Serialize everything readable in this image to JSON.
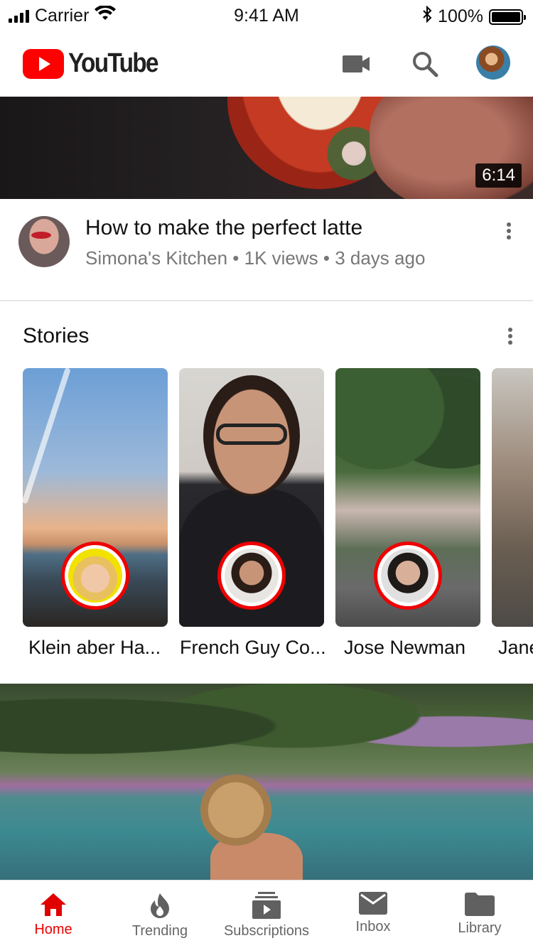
{
  "status_bar": {
    "carrier": "Carrier",
    "time": "9:41 AM",
    "battery": "100%"
  },
  "header": {
    "logo_text": "YouTube",
    "icons": [
      "video-camera-icon",
      "search-icon",
      "avatar"
    ]
  },
  "featured_video": {
    "duration": "6:14",
    "title": "How to make the perfect latte",
    "meta": "Simona's Kitchen • 1K views • 3 days ago"
  },
  "stories": {
    "title": "Stories",
    "items": [
      {
        "label": "Klein aber Ha..."
      },
      {
        "label": "French Guy Co..."
      },
      {
        "label": "Jose Newman"
      },
      {
        "label": "Jane"
      }
    ]
  },
  "tabs": [
    {
      "label": "Home",
      "icon": "home-icon",
      "active": true
    },
    {
      "label": "Trending",
      "icon": "flame-icon",
      "active": false
    },
    {
      "label": "Subscriptions",
      "icon": "subscriptions-icon",
      "active": false
    },
    {
      "label": "Inbox",
      "icon": "mail-icon",
      "active": false
    },
    {
      "label": "Library",
      "icon": "folder-icon",
      "active": false
    }
  ],
  "colors": {
    "brand_red": "#FF0000",
    "active_tab": "#E00000",
    "icon_gray": "#606060"
  }
}
